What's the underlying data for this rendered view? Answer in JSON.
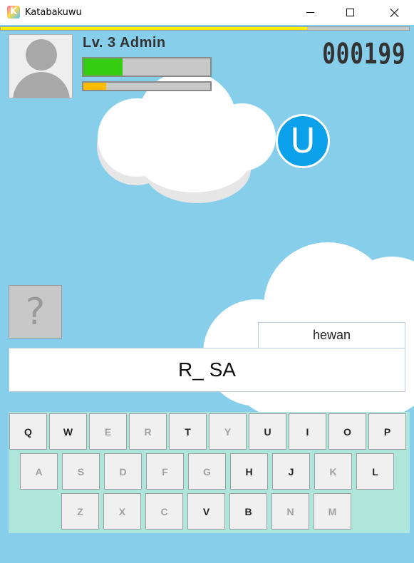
{
  "window": {
    "title": "Katabakuwu",
    "app_icon_letter": "K"
  },
  "timer": {
    "remaining_fraction": 0.75
  },
  "player": {
    "name": "Lv. 3 Admin",
    "health_fraction": 0.31,
    "xp_fraction": 0.18,
    "avatar_icon": "user-silhouette-icon"
  },
  "score": "000199",
  "falling_letter": "U",
  "hint": {
    "symbol": "?"
  },
  "category": "hewan",
  "puzzle_word": "R_ SA",
  "colors": {
    "sky": "#87ceeb",
    "health": "#33cc11",
    "xp": "#ffbb00",
    "timer": "#ffee00",
    "letter_bubble": "#0aa0ea",
    "keyboard_bg": "#aee6dc"
  },
  "keyboard": {
    "rows": [
      [
        {
          "label": "Q",
          "enabled": true
        },
        {
          "label": "W",
          "enabled": true
        },
        {
          "label": "E",
          "enabled": false
        },
        {
          "label": "R",
          "enabled": false
        },
        {
          "label": "T",
          "enabled": true
        },
        {
          "label": "Y",
          "enabled": false
        },
        {
          "label": "U",
          "enabled": true
        },
        {
          "label": "I",
          "enabled": true
        },
        {
          "label": "O",
          "enabled": true
        },
        {
          "label": "P",
          "enabled": true
        }
      ],
      [
        {
          "label": "A",
          "enabled": false
        },
        {
          "label": "S",
          "enabled": false
        },
        {
          "label": "D",
          "enabled": false
        },
        {
          "label": "F",
          "enabled": false
        },
        {
          "label": "G",
          "enabled": false
        },
        {
          "label": "H",
          "enabled": true
        },
        {
          "label": "J",
          "enabled": true
        },
        {
          "label": "K",
          "enabled": false
        },
        {
          "label": "L",
          "enabled": true
        }
      ],
      [
        {
          "label": "Z",
          "enabled": false
        },
        {
          "label": "X",
          "enabled": false
        },
        {
          "label": "C",
          "enabled": false
        },
        {
          "label": "V",
          "enabled": true
        },
        {
          "label": "B",
          "enabled": true
        },
        {
          "label": "N",
          "enabled": false
        },
        {
          "label": "M",
          "enabled": false
        }
      ]
    ]
  }
}
